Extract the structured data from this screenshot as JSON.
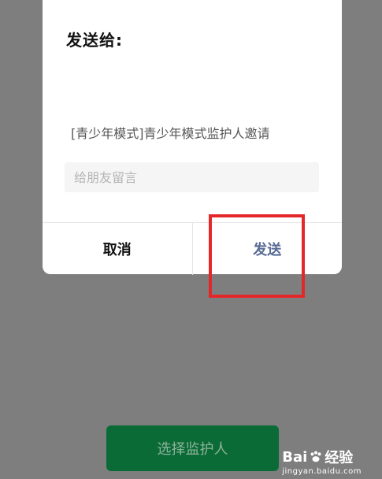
{
  "dialog": {
    "title": "发送给:",
    "message": "[青少年模式]青少年模式监护人邀请",
    "note_placeholder": "给朋友留言",
    "cancel_label": "取消",
    "send_label": "发送"
  },
  "background_action": {
    "label": "选择监护人"
  },
  "watermark": {
    "brand_left": "Bai",
    "brand_right": "经验",
    "url": "jingyan.baidu.com"
  },
  "colors": {
    "overlay": "#7e7e7e",
    "send": "#576b95",
    "highlight": "#e4282a",
    "primary_green": "#0a6b37"
  }
}
